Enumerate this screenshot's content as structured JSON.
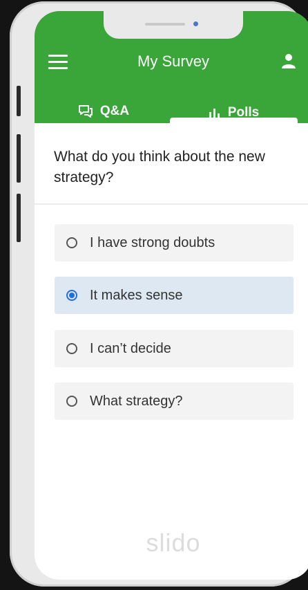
{
  "header": {
    "title": "My Survey",
    "accent_color": "#3aa63a",
    "menu_icon": "hamburger-menu-icon",
    "user_icon": "user-icon"
  },
  "tabs": [
    {
      "label": "Q&A",
      "icon": "chat-bubbles-icon",
      "active": false
    },
    {
      "label": "Polls",
      "icon": "bar-chart-icon",
      "active": true
    }
  ],
  "poll": {
    "question": "What do you think about the new strategy?",
    "options": [
      {
        "label": "I have strong doubts",
        "selected": false
      },
      {
        "label": "It makes sense",
        "selected": true
      },
      {
        "label": "I can’t decide",
        "selected": false
      },
      {
        "label": "What strategy?",
        "selected": false
      }
    ],
    "selected_color": "#1f6fe0"
  },
  "brand": {
    "wordmark": "slido"
  }
}
